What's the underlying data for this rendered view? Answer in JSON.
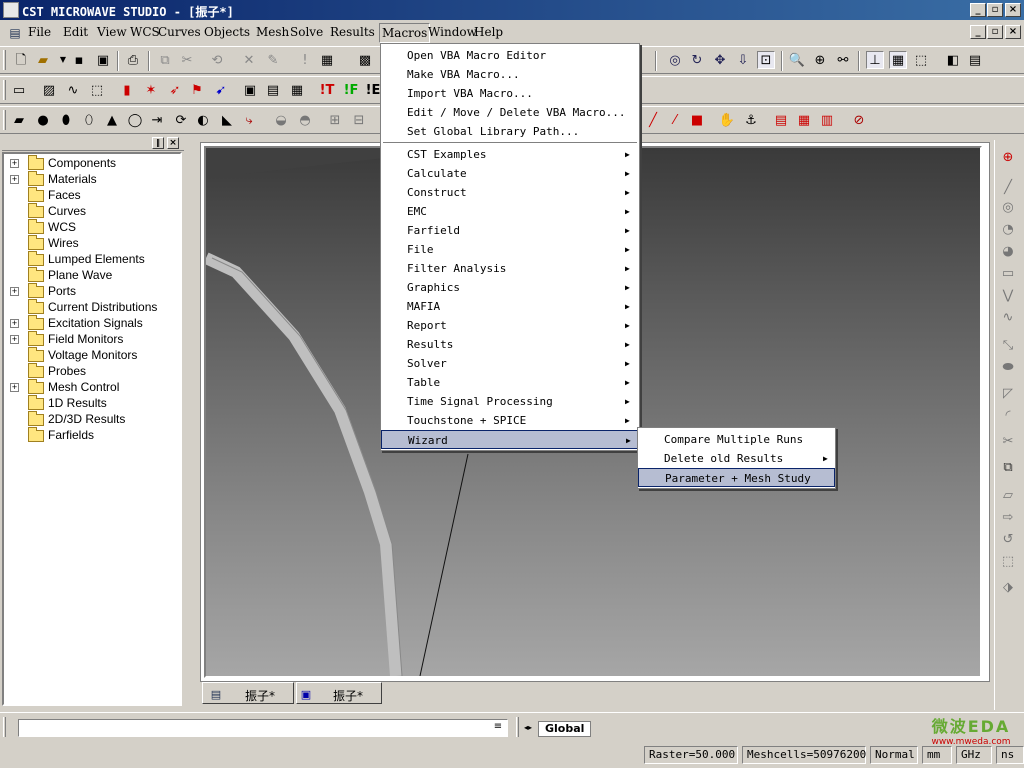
{
  "window": {
    "title": "CST MICROWAVE STUDIO - [振子*]"
  },
  "menubar": [
    "File",
    "Edit",
    "View",
    "WCS",
    "Curves",
    "Objects",
    "Mesh",
    "Solve",
    "Results",
    "Macros",
    "Window",
    "Help"
  ],
  "menubar_active": "Macros",
  "tree": {
    "items": [
      {
        "label": "Components",
        "expandable": true
      },
      {
        "label": "Materials",
        "expandable": true
      },
      {
        "label": "Faces",
        "expandable": false
      },
      {
        "label": "Curves",
        "expandable": false
      },
      {
        "label": "WCS",
        "expandable": false
      },
      {
        "label": "Wires",
        "expandable": false
      },
      {
        "label": "Lumped Elements",
        "expandable": false
      },
      {
        "label": "Plane Wave",
        "expandable": false
      },
      {
        "label": "Ports",
        "expandable": true
      },
      {
        "label": "Current Distributions",
        "expandable": false
      },
      {
        "label": "Excitation Signals",
        "expandable": true
      },
      {
        "label": "Field Monitors",
        "expandable": true
      },
      {
        "label": "Voltage Monitors",
        "expandable": false
      },
      {
        "label": "Probes",
        "expandable": false
      },
      {
        "label": "Mesh Control",
        "expandable": true
      },
      {
        "label": "1D Results",
        "expandable": false
      },
      {
        "label": "2D/3D Results",
        "expandable": false
      },
      {
        "label": "Farfields",
        "expandable": false
      }
    ]
  },
  "macros_menu": {
    "top_items": [
      "Open VBA Macro Editor",
      "Make VBA Macro...",
      "Import VBA Macro...",
      "Edit / Move / Delete VBA Macro...",
      "Set Global Library Path..."
    ],
    "sub_items": [
      "CST Examples",
      "Calculate",
      "Construct",
      "EMC",
      "Farfield",
      "File",
      "Filter Analysis",
      "Graphics",
      "MAFIA",
      "Report",
      "Results",
      "Solver",
      "Table",
      "Time Signal Processing",
      "Touchstone + SPICE",
      "Wizard"
    ],
    "highlighted": "Wizard"
  },
  "wizard_menu": {
    "items": [
      {
        "label": "Compare Multiple Runs",
        "submenu": false
      },
      {
        "label": "Delete old Results",
        "submenu": true
      },
      {
        "label": "Parameter + Mesh Study",
        "submenu": false
      }
    ],
    "highlighted": "Parameter + Mesh Study"
  },
  "doc_tabs": [
    "振子*",
    "振子*"
  ],
  "command_bar": {
    "global_tab": "Global"
  },
  "watermark": {
    "text": "微波EDA",
    "url": "www.mweda.com"
  },
  "status": {
    "raster": "Raster=50.000",
    "meshcells": "Meshcells=50976200",
    "mode": "Normal",
    "unit_length": "mm",
    "unit_freq": "GHz",
    "unit_time": "ns"
  },
  "colors": {
    "title_start": "#0a246a",
    "title_end": "#3a6ea5",
    "menu_highlight": "#b6bdd2",
    "viewport_top": "#3a3a3a",
    "viewport_bottom": "#a6a6a6"
  }
}
